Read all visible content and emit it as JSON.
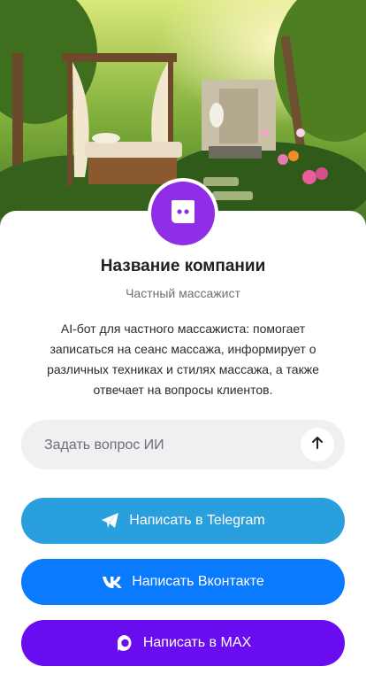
{
  "company": {
    "name": "Название компании",
    "subtitle": "Частный массажист",
    "description": "AI-бот для частного массажиста: помогает записаться на сеанс массажа, информирует о различных техниках и стилях массажа, а также отвечает на вопросы клиентов."
  },
  "ask": {
    "placeholder": "Задать вопрос ИИ",
    "value": ""
  },
  "buttons": {
    "telegram": "Написать в Telegram",
    "vk": "Написать Вконтакте",
    "max": "Написать в MAX"
  },
  "icons": {
    "avatar": "chat-bubble-icon",
    "send": "arrow-up-icon",
    "telegram": "telegram-icon",
    "vk": "vk-icon",
    "max": "max-icon"
  },
  "colors": {
    "avatar_bg": "#8f2ee6",
    "telegram": "#2a9fde",
    "vk": "#0a7aff",
    "max": "#6a0cf0",
    "ask_bg": "#f0f0f2"
  }
}
